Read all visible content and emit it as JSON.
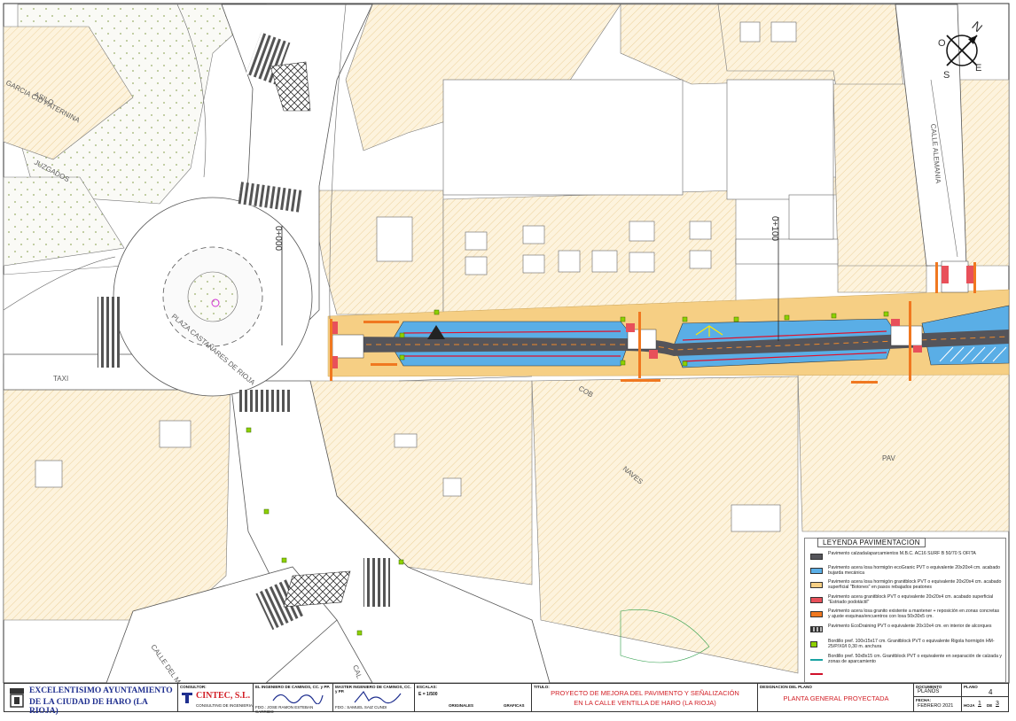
{
  "map": {
    "street_labels": {
      "garcia_paternina": "GARCIA CID PATERNINA",
      "asilo": "ASILO",
      "juzgados": "JUZGADOS",
      "plaza": "PLAZA CASTAÑARES DE RIOJA",
      "calle_alemania": "CALLE ALEMANIA",
      "cob": "COB",
      "naves": "NAVES",
      "pav": "PAV",
      "calle_del_mazo": "CALLE DEL MAZO",
      "calle_partial": "CAL",
      "taxi": "TAXI"
    },
    "chainage": [
      "0+000",
      "0+100"
    ],
    "compass_letters": {
      "n": "N",
      "o": "O",
      "e": "E",
      "s": "S"
    },
    "colors": {
      "road_asphalt": "#54545a",
      "sidewalk_blue": "#5aaee6",
      "sidewalk_yellow": "#f6cf84",
      "red_paving": "#e8505a",
      "orange_paving": "#f07820",
      "green_ecodrain": "#8ed000",
      "curb_red": "#e0102a",
      "hatch_parcel": "#fbeed2"
    }
  },
  "legend": {
    "title": "LEYENDA PAVIMENTACION",
    "items": [
      {
        "swatch": "#54545a",
        "text": "Pavimento calzada/aparcamientos M.B.C. AC16 SURF B 50/70 S OFITA"
      },
      {
        "swatch": "#5aaee6",
        "text": "Pavimento acera losa hormigón ecoGranic PVT o equivalente 20x20x4 cm. acabado bujarda mecánica"
      },
      {
        "swatch": "#f6cf84",
        "text": "Pavimento acera losa hormigón granitblock PVT o equivalente 20x20x4 cm. acabado superficial \"Botones\" en pasos rebajados peatones"
      },
      {
        "swatch": "#e8505a",
        "text": "Pavimento acera granitblock PVT o equivalente 20x20x4 cm. acabado superficial \"Estriado podotáctil\""
      },
      {
        "swatch": "#f07820",
        "text": "Pavimento acera losa granito existente a mantener + reposición en zonas concretas y ajuste esquinas/encuentros con losa 50x30x5 cm."
      },
      {
        "swatch": "#333333",
        "text": "Pavimento EcoDraining PVT o equivalente 20x10x4 cm. en interior de alcorques"
      },
      {
        "swatch": "#8ed000",
        "text": "Bordillo pref. 100x15x17 cm. Granitblock PVT o equivalente Rigola hormigón HM-25/P/X0/I 0,30 m. anchura"
      },
      {
        "swatch": "#19a3a3",
        "text": "Bordillo pref. 50x8x15 cm. Granitblock PVT o equivalente en separación de calzada y zonas de aparcamiento"
      },
      {
        "swatch": "#d0102a",
        "text": ""
      }
    ]
  },
  "title_block": {
    "org_line1": "EXCELENTISIMO AYUNTAMIENTO",
    "org_line2": "DE LA CIUDAD DE HARO (LA RIOJA)",
    "consultor_label": "CONSULTOR:",
    "consultor_name": "CINTEC, S.L.",
    "consultor_sub": "CONSULTING DE INGENIERIA",
    "engineer_label": "EL INGENIERO DE CAMINOS, CC. y PP.",
    "engineer_name": "FDO.: JOSE RAMON ESTEBAN CARRIDO",
    "master_label": "MASTER INGENIERO DE CAMINOS, CC. y PP.",
    "master_name": "FDO.: SAMUEL SAIZ CUNDI",
    "scale_label": "ESCALAS:",
    "scale_value": "E = 1/500",
    "originales": "ORIGINALES",
    "graficas": "GRAFICAS",
    "titulo_label": "TITULO:",
    "project_line1": "PROYECTO DE MEJORA DEL PAVIMENTO Y SEÑALIZACIÓN",
    "project_line2": "EN LA CALLE VENTILLA DE HARO (LA RIOJA)",
    "designation_label": "DESIGNACION DEL PLANO",
    "designation_value": "PLANTA GENERAL PROYECTADA",
    "document_label": "DOCUMENTO",
    "document_value": "PLANOS",
    "plano_label": "PLANO",
    "plano_value": "4",
    "fecha_label": "FECHA:",
    "fecha_value": "FEBRERO 2021",
    "hoja_label": "HOJA",
    "hoja_value": "1",
    "hoja_de": "DE",
    "hoja_total": "3"
  }
}
